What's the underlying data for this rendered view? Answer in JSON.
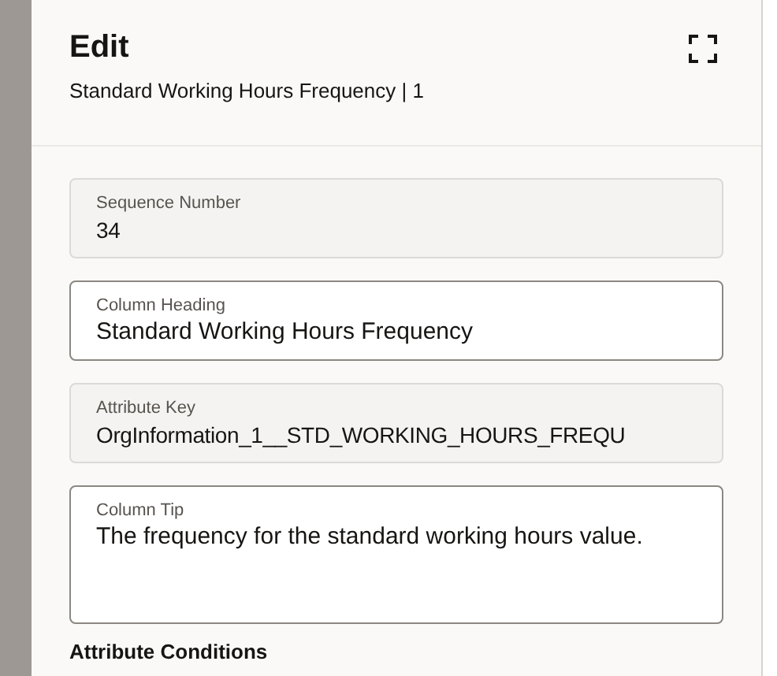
{
  "header": {
    "title": "Edit",
    "subtitle": "Standard Working Hours Frequency | 1"
  },
  "fields": [
    {
      "kind": "readonly",
      "label": "Sequence Number",
      "value": "34"
    },
    {
      "kind": "text",
      "label": "Column Heading",
      "value": "Standard Working Hours Frequency"
    },
    {
      "kind": "readonly",
      "label": "Attribute Key",
      "value": "OrgInformation_1__STD_WORKING_HOURS_FREQU"
    },
    {
      "kind": "textarea",
      "label": "Column Tip",
      "value": "The frequency for the standard working hours value."
    }
  ],
  "section_heading": "Attribute Conditions"
}
